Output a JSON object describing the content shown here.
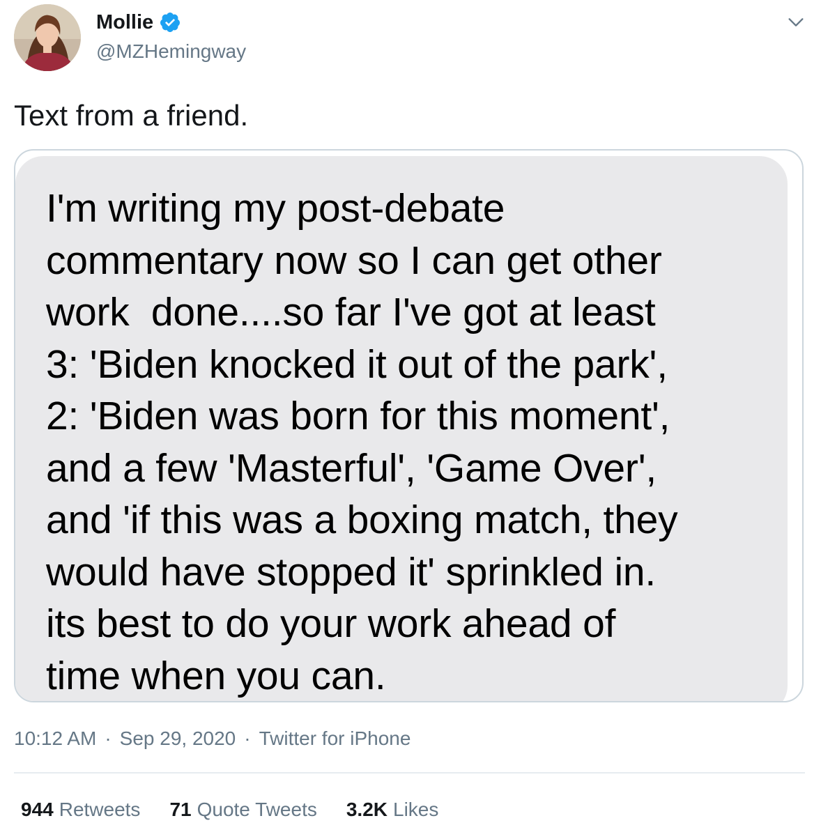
{
  "author": {
    "display_name": "Mollie",
    "handle": "@MZHemingway",
    "verified": true,
    "avatar_icon": "profile-photo"
  },
  "tweet": {
    "text": "Text from a friend."
  },
  "media": {
    "message_lines": [
      "I'm writing my post-debate",
      "commentary now so I can get other",
      "work  done....so far I've got at least",
      "3: 'Biden knocked it out of the park',",
      "2: 'Biden was born for this moment',",
      "and a few 'Masterful', 'Game Over',",
      "and 'if this was a boxing match, they",
      "would have stopped it' sprinkled in.",
      "its best to do your work ahead of",
      "time when you can."
    ]
  },
  "meta": {
    "time": "10:12 AM",
    "separator": "·",
    "date": "Sep 29, 2020",
    "source": "Twitter for iPhone"
  },
  "stats": {
    "retweets": {
      "count": "944",
      "label": "Retweets"
    },
    "quotes": {
      "count": "71",
      "label": "Quote Tweets"
    },
    "likes": {
      "count": "3.2K",
      "label": "Likes"
    }
  },
  "colors": {
    "verified": "#1da1f2",
    "secondary_text": "#657786",
    "bubble": "#e9e9eb",
    "border": "#ccd6dd"
  }
}
